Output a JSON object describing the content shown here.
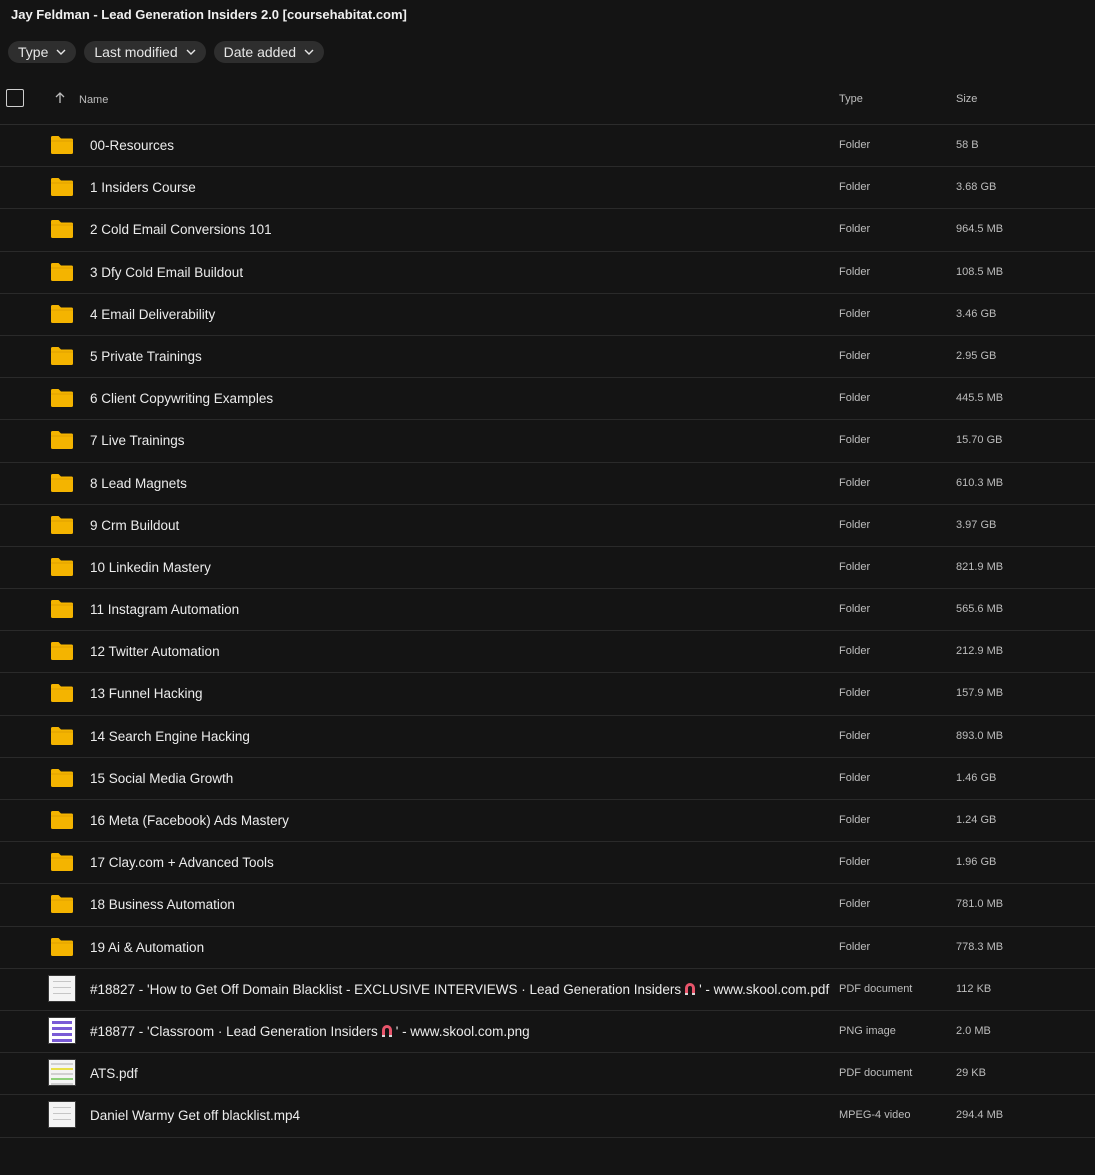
{
  "title": "Jay Feldman - Lead Generation Insiders 2.0 [coursehabitat.com]",
  "filters": [
    {
      "label": "Type"
    },
    {
      "label": "Last modified"
    },
    {
      "label": "Date added"
    }
  ],
  "columns": {
    "name": "Name",
    "type": "Type",
    "size": "Size"
  },
  "folders": [
    {
      "name": "00-Resources",
      "type": "Folder",
      "size": "58 B"
    },
    {
      "name": "1 Insiders Course",
      "type": "Folder",
      "size": "3.68 GB"
    },
    {
      "name": "2 Cold Email Conversions 101",
      "type": "Folder",
      "size": "964.5 MB"
    },
    {
      "name": "3 Dfy Cold Email Buildout",
      "type": "Folder",
      "size": "108.5 MB"
    },
    {
      "name": "4 Email Deliverability",
      "type": "Folder",
      "size": "3.46 GB"
    },
    {
      "name": "5 Private Trainings",
      "type": "Folder",
      "size": "2.95 GB"
    },
    {
      "name": "6 Client Copywriting Examples",
      "type": "Folder",
      "size": "445.5 MB"
    },
    {
      "name": "7 Live Trainings",
      "type": "Folder",
      "size": "15.70 GB"
    },
    {
      "name": "8 Lead Magnets",
      "type": "Folder",
      "size": "610.3 MB"
    },
    {
      "name": "9 Crm Buildout",
      "type": "Folder",
      "size": "3.97 GB"
    },
    {
      "name": "10 Linkedin Mastery",
      "type": "Folder",
      "size": "821.9 MB"
    },
    {
      "name": "11 Instagram Automation",
      "type": "Folder",
      "size": "565.6 MB"
    },
    {
      "name": "12 Twitter Automation",
      "type": "Folder",
      "size": "212.9 MB"
    },
    {
      "name": "13 Funnel Hacking",
      "type": "Folder",
      "size": "157.9 MB"
    },
    {
      "name": "14 Search Engine Hacking",
      "type": "Folder",
      "size": "893.0 MB"
    },
    {
      "name": "15 Social Media Growth",
      "type": "Folder",
      "size": "1.46 GB"
    },
    {
      "name": "16 Meta (Facebook) Ads Mastery",
      "type": "Folder",
      "size": "1.24 GB"
    },
    {
      "name": "17 Clay.com + Advanced Tools",
      "type": "Folder",
      "size": "1.96 GB"
    },
    {
      "name": "18 Business Automation",
      "type": "Folder",
      "size": "781.0 MB"
    },
    {
      "name": "19 Ai & Automation",
      "type": "Folder",
      "size": "778.3 MB"
    }
  ],
  "files": [
    {
      "name_before": "#18827 - 'How to Get Off Domain Blacklist - EXCLUSIVE INTERVIEWS · Lead Generation Insiders",
      "icon": "magnet-icon",
      "name_after": "' - www.skool.com.pdf",
      "type": "PDF document",
      "size": "112 KB"
    },
    {
      "name_before": "#18877 - 'Classroom · Lead Generation Insiders",
      "icon": "magnet-icon",
      "name_after": "' - www.skool.com.png",
      "type": "PNG image",
      "size": "2.0 MB"
    },
    {
      "name_before": "ATS.pdf",
      "icon": "",
      "name_after": "",
      "type": "PDF document",
      "size": "29 KB"
    },
    {
      "name_before": "Daniel Warmy Get off blacklist.mp4",
      "icon": "",
      "name_after": "",
      "type": "MPEG-4 video",
      "size": "294.4 MB"
    }
  ],
  "colors": {
    "background": "#141414",
    "folder": "#f4b400",
    "chip": "#2e2e2e",
    "magnet": "#e8556b"
  }
}
